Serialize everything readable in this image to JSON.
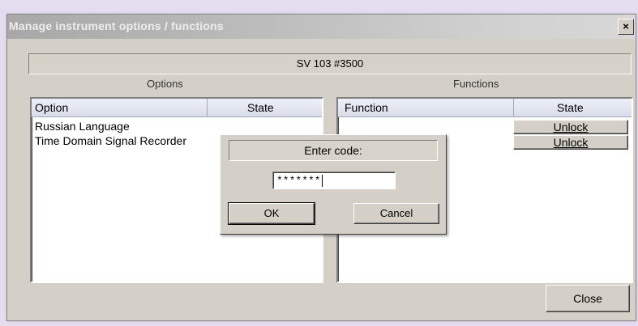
{
  "window": {
    "title": "Manage instrument options / functions",
    "close_glyph": "×"
  },
  "device": {
    "name": "SV 103 #3500"
  },
  "options": {
    "group_label": "Options",
    "columns": [
      "Option",
      "State"
    ],
    "rows": [
      {
        "option": "Russian Language",
        "state": ""
      },
      {
        "option": "Time Domain Signal Recorder",
        "state": ""
      }
    ]
  },
  "functions": {
    "group_label": "Functions",
    "columns": [
      "Function",
      "State"
    ],
    "rows": [
      {
        "function": "",
        "state": "Unlock"
      },
      {
        "function": "",
        "state": "Unlock"
      }
    ]
  },
  "dialog": {
    "prompt": "Enter code:",
    "code_value": "*******",
    "ok_label": "OK",
    "cancel_label": "Cancel"
  },
  "footer": {
    "close_label": "Close"
  }
}
